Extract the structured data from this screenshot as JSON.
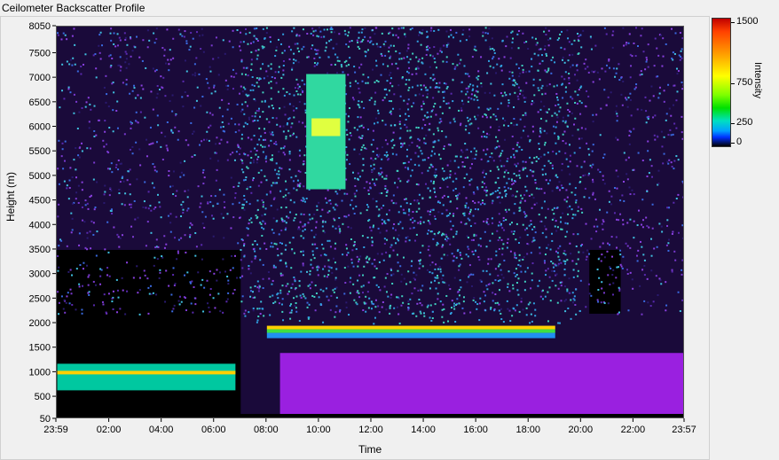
{
  "window": {
    "title": "Ceilometer Backscatter Profile"
  },
  "colorbar": {
    "title": "Intensity",
    "labels": [
      "1500",
      "750",
      "250",
      "0"
    ]
  },
  "chart_data": {
    "type": "heatmap",
    "xlabel": "Time",
    "ylabel": "Height (m)",
    "x_ticks": [
      "23:59",
      "02:00",
      "04:00",
      "06:00",
      "08:00",
      "10:00",
      "12:00",
      "14:00",
      "16:00",
      "18:00",
      "20:00",
      "22:00",
      "23:57"
    ],
    "y_ticks": [
      8050,
      7500,
      7000,
      6500,
      6000,
      5500,
      5000,
      4500,
      4000,
      3500,
      3000,
      2500,
      2000,
      1500,
      1000,
      500,
      50
    ],
    "ylim": [
      50,
      8050
    ],
    "xlim_hours": [
      -0.0167,
      23.95
    ],
    "colorscale": {
      "min": 0,
      "max": 1500
    },
    "features": [
      {
        "name": "boundary_layer_top",
        "from_hour": 8,
        "to_hour": 19,
        "height": 1900
      },
      {
        "name": "low_cloud_layer",
        "from_hour": 0,
        "to_hour": 6.8,
        "height": 1000
      },
      {
        "name": "elevated_plume",
        "from_hour": 9.5,
        "to_hour": 11,
        "height": 6000
      }
    ]
  }
}
